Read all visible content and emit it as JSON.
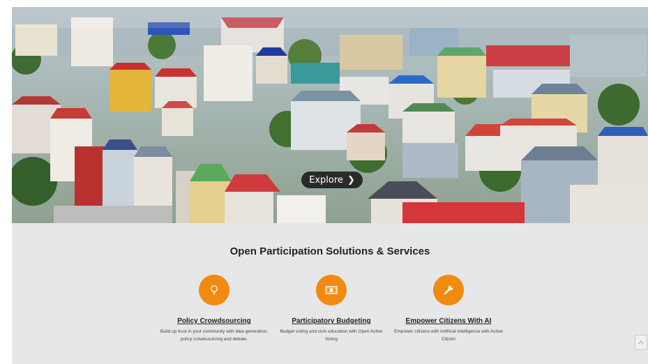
{
  "hero": {
    "explore_label": "Explore"
  },
  "section": {
    "title": "Open Participation Solutions & Services"
  },
  "services": [
    {
      "icon": "lightbulb-icon",
      "title": "Policy Crowdsourcing",
      "description": "Build up trust in your community with idea generation, policy crowdsourcing and debate."
    },
    {
      "icon": "money-icon",
      "title": "Participatory Budgeting",
      "description": "Budget voting and civic education with Open Active Voting"
    },
    {
      "icon": "wrench-icon",
      "title": "Empower Citizens With AI",
      "description": "Empower citizens with Artificial Intelligence with Active Citizen"
    }
  ],
  "colors": {
    "accent": "#f18a0e",
    "section_bg": "#e6e7e9",
    "explore_bg": "#1a1a1a"
  }
}
